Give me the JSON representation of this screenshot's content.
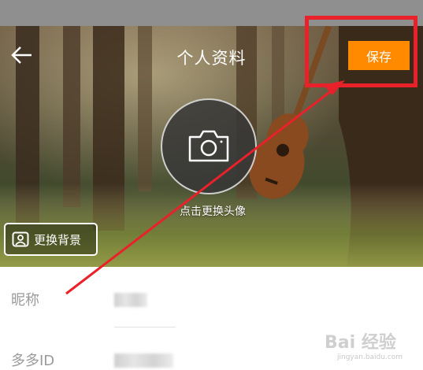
{
  "header": {
    "title": "个人资料",
    "save_label": "保存"
  },
  "avatar": {
    "caption": "点击更换头像"
  },
  "background_button": {
    "label": "更换背景"
  },
  "form": {
    "rows": [
      {
        "label": "昵称"
      },
      {
        "label": "多多ID"
      }
    ]
  },
  "watermark": {
    "text": "Bai 经验",
    "sub": "jingyan.baidu.com"
  },
  "colors": {
    "accent": "#ff8a00",
    "annotation": "#e8212a",
    "status_bar": "#8f8f8f"
  }
}
